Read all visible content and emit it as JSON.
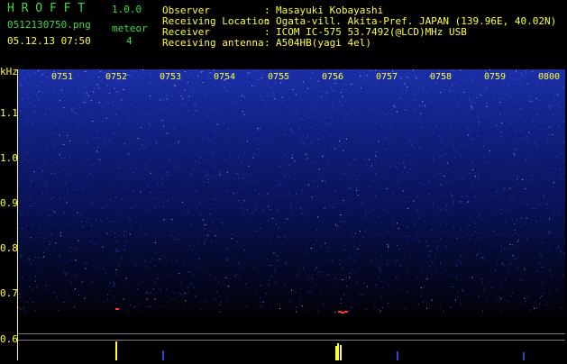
{
  "header": {
    "app_title": "H R O F F T",
    "version": "1.0.0",
    "filename": "0512130750.png",
    "meteor_label": "meteor",
    "meteor_count": "4",
    "datetime": "05.12.13 07:50"
  },
  "info": [
    {
      "key": "Observer",
      "sep": ":",
      "value": "Masayuki Kobayashi"
    },
    {
      "key": "Receiving Location",
      "sep": ":",
      "value": "Ogata-vill. Akita-Pref. JAPAN (139.96E, 40.02N)"
    },
    {
      "key": "Receiver",
      "sep": ":",
      "value": "ICOM IC-575 53.7492(@LCD)MHz USB"
    },
    {
      "key": "Receiving antenna",
      "sep": ":",
      "value": "A504HB(yagi 4el)"
    }
  ],
  "axes": {
    "y_unit": "kHz",
    "y_ticks": [
      "1.1",
      "1.0",
      "0.9",
      "0.8",
      "0.7",
      "0.6"
    ],
    "x_ticks": [
      "0751",
      "0752",
      "0753",
      "0754",
      "0755",
      "0756",
      "0757",
      "0758",
      "0759",
      "0800"
    ]
  },
  "colors": {
    "spectrogram_background": "#000066",
    "noise": "#3344cc",
    "text_header": "#3ddc3d",
    "text_labels": "#ffff33",
    "meteor_echo": "#ff3333"
  }
}
